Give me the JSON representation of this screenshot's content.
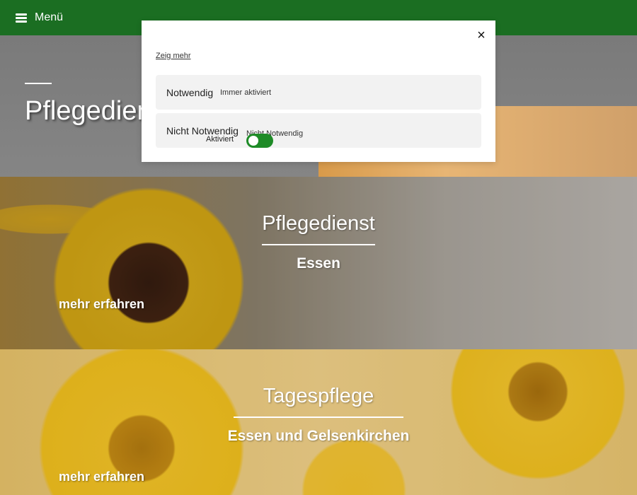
{
  "nav": {
    "menu_label": "Menü",
    "menu_icon": "hamburger-icon",
    "bar_color": "#1b6e22"
  },
  "hero": {
    "title": "Pflegedienst Sonnenblume"
  },
  "blocks": [
    {
      "title": "Pflegedienst",
      "subtitle": "Essen",
      "link": "mehr erfahren"
    },
    {
      "title": "Tagespflege",
      "subtitle": "Essen und Gelsenkirchen",
      "link": "mehr erfahren"
    }
  ],
  "cookie_modal": {
    "show_more": "Zeig mehr",
    "close_icon": "close-icon",
    "close_glyph": "×",
    "categories": [
      {
        "title": "Notwendig",
        "badge": "Immer aktiviert"
      },
      {
        "title": "Nicht Notwendig",
        "badge": "Nicht Notwendig",
        "toggle_label": "Aktiviert",
        "toggle_on": true
      }
    ],
    "accent_color": "#1e8b27"
  }
}
